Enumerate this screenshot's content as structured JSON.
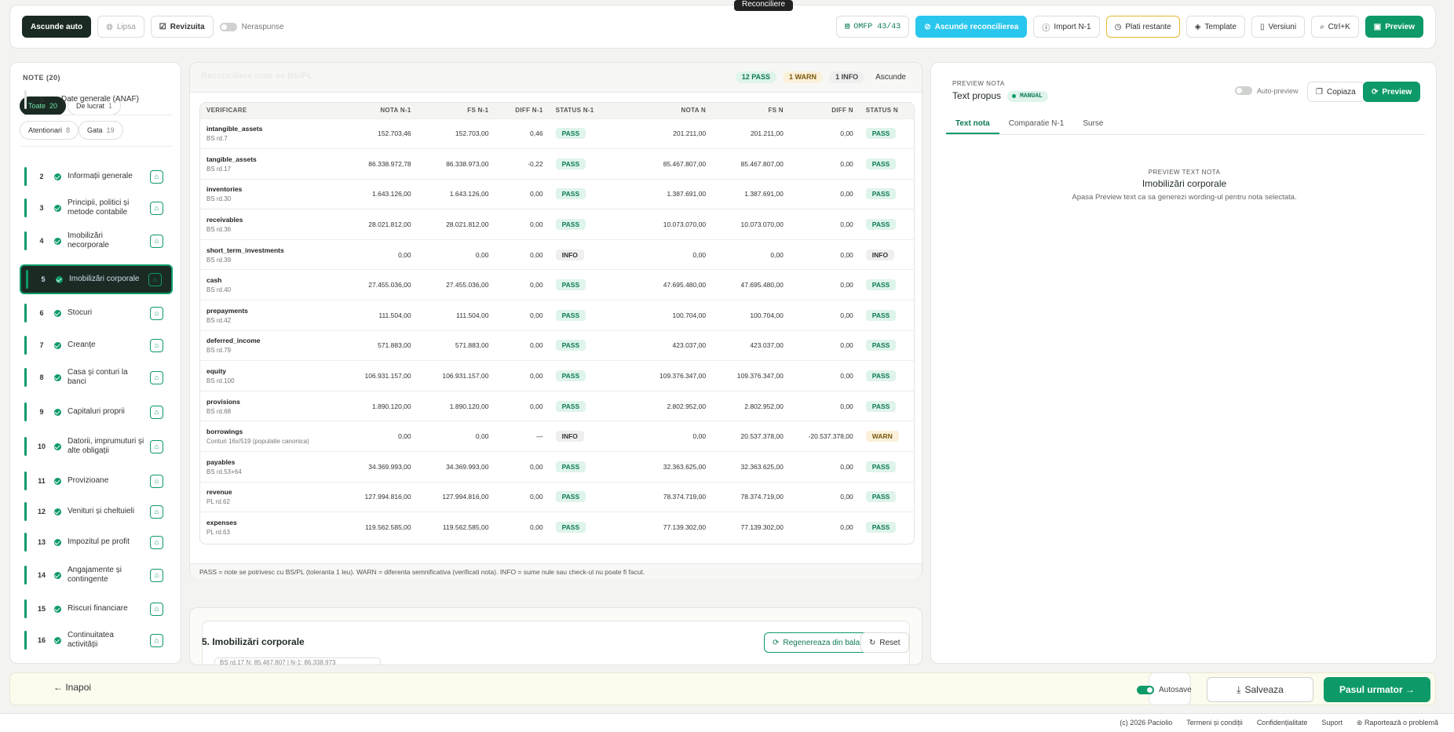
{
  "topbar": {
    "hide_auto": "Ascunde auto",
    "missing": "Lipsa",
    "reviewed": "Revizuita",
    "unanswered": "Neraspunse",
    "omfp": "OMFP 43/43",
    "tooltip": "Reconciliere",
    "hide_reconciliation": "Ascunde reconcilierea",
    "import": "Import N-1",
    "overdue": "Plati restante",
    "template": "Template",
    "versions": "Versiuni",
    "shortcut": "Ctrl+K",
    "preview": "Preview"
  },
  "sidebar": {
    "title": "NOTE (20)",
    "filters": [
      {
        "label": "Toate",
        "count": "20"
      },
      {
        "label": "De lucrat",
        "count": "1"
      },
      {
        "label": "Atentionari",
        "count": "8"
      },
      {
        "label": "Gata",
        "count": "19"
      }
    ],
    "items": [
      {
        "num": "1",
        "label": "Date generale (ANAF)"
      },
      {
        "num": "2",
        "label": "Informații generale"
      },
      {
        "num": "3",
        "label": "Principii, politici și metode contabile"
      },
      {
        "num": "4",
        "label": "Imobilizări necorporale"
      },
      {
        "num": "5",
        "label": "Imobilizări corporale"
      },
      {
        "num": "6",
        "label": "Stocuri"
      },
      {
        "num": "7",
        "label": "Creanțe"
      },
      {
        "num": "8",
        "label": "Casa și conturi la banci"
      },
      {
        "num": "9",
        "label": "Capitaluri proprii"
      },
      {
        "num": "10",
        "label": "Datorii, imprumuturi și alte obligații"
      },
      {
        "num": "11",
        "label": "Provizioane"
      },
      {
        "num": "12",
        "label": "Venituri și cheltuieli"
      },
      {
        "num": "13",
        "label": "Impozitul pe profit"
      },
      {
        "num": "14",
        "label": "Angajamente și contingente"
      },
      {
        "num": "15",
        "label": "Riscuri financiare"
      },
      {
        "num": "16",
        "label": "Continuitatea activității"
      }
    ]
  },
  "recon": {
    "header_faint": "Reconciliere note vs BS/PL",
    "pass": "12 PASS",
    "warn": "1 WARN",
    "info": "1 INFO",
    "hide": "Ascunde",
    "columns": [
      "VERIFICARE",
      "NOTA N-1",
      "FS N-1",
      "DIFF N-1",
      "STATUS N-1",
      "NOTA N",
      "FS N",
      "DIFF N",
      "STATUS N"
    ],
    "rows": [
      {
        "key": "intangible_assets",
        "src": "BS rd.7",
        "nota1": "152.703,46",
        "fs1": "152.703,00",
        "diff1": "0,46",
        "st1": "PASS",
        "nota": "201.211,00",
        "fs": "201.211,00",
        "diff": "0,00",
        "st": "PASS"
      },
      {
        "key": "tangible_assets",
        "src": "BS rd.17",
        "nota1": "86.338.972,78",
        "fs1": "86.338.973,00",
        "diff1": "-0,22",
        "st1": "PASS",
        "nota": "85.467.807,00",
        "fs": "85.467.807,00",
        "diff": "0,00",
        "st": "PASS"
      },
      {
        "key": "inventories",
        "src": "BS rd.30",
        "nota1": "1.643.126,00",
        "fs1": "1.643.126,00",
        "diff1": "0,00",
        "st1": "PASS",
        "nota": "1.387.691,00",
        "fs": "1.387.691,00",
        "diff": "0,00",
        "st": "PASS"
      },
      {
        "key": "receivables",
        "src": "BS rd.36",
        "nota1": "28.021.812,00",
        "fs1": "28.021.812,00",
        "diff1": "0,00",
        "st1": "PASS",
        "nota": "10.073.070,00",
        "fs": "10.073.070,00",
        "diff": "0,00",
        "st": "PASS"
      },
      {
        "key": "short_term_investments",
        "src": "BS rd.39",
        "nota1": "0,00",
        "fs1": "0,00",
        "diff1": "0,00",
        "st1": "INFO",
        "nota": "0,00",
        "fs": "0,00",
        "diff": "0,00",
        "st": "INFO"
      },
      {
        "key": "cash",
        "src": "BS rd.40",
        "nota1": "27.455.036,00",
        "fs1": "27.455.036,00",
        "diff1": "0,00",
        "st1": "PASS",
        "nota": "47.695.480,00",
        "fs": "47.695.480,00",
        "diff": "0,00",
        "st": "PASS"
      },
      {
        "key": "prepayments",
        "src": "BS rd.42",
        "nota1": "111.504,00",
        "fs1": "111.504,00",
        "diff1": "0,00",
        "st1": "PASS",
        "nota": "100.704,00",
        "fs": "100.704,00",
        "diff": "0,00",
        "st": "PASS"
      },
      {
        "key": "deferred_income",
        "src": "BS rd.79",
        "nota1": "571.883,00",
        "fs1": "571.883,00",
        "diff1": "0,00",
        "st1": "PASS",
        "nota": "423.037,00",
        "fs": "423.037,00",
        "diff": "0,00",
        "st": "PASS"
      },
      {
        "key": "equity",
        "src": "BS rd.100",
        "nota1": "106.931.157,00",
        "fs1": "106.931.157,00",
        "diff1": "0,00",
        "st1": "PASS",
        "nota": "109.376.347,00",
        "fs": "109.376.347,00",
        "diff": "0,00",
        "st": "PASS"
      },
      {
        "key": "provisions",
        "src": "BS rd.68",
        "nota1": "1.890.120,00",
        "fs1": "1.890.120,00",
        "diff1": "0,00",
        "st1": "PASS",
        "nota": "2.802.952,00",
        "fs": "2.802.952,00",
        "diff": "0,00",
        "st": "PASS"
      },
      {
        "key": "borrowings",
        "src": "Conturi 16x/519 (populatie canonica)",
        "nota1": "0,00",
        "fs1": "0,00",
        "diff1": "—",
        "st1": "INFO",
        "nota": "0,00",
        "fs": "20.537.378,00",
        "diff": "-20.537.378,00",
        "st": "WARN"
      },
      {
        "key": "payables",
        "src": "BS rd.53+64",
        "nota1": "34.369.993,00",
        "fs1": "34.369.993,00",
        "diff1": "0,00",
        "st1": "PASS",
        "nota": "32.363.625,00",
        "fs": "32.363.625,00",
        "diff": "0,00",
        "st": "PASS"
      },
      {
        "key": "revenue",
        "src": "PL rd.62",
        "nota1": "127.994.816,00",
        "fs1": "127.994.816,00",
        "diff1": "0,00",
        "st1": "PASS",
        "nota": "78.374.719,00",
        "fs": "78.374.719,00",
        "diff": "0,00",
        "st": "PASS"
      },
      {
        "key": "expenses",
        "src": "PL rd.63",
        "nota1": "119.562.585,00",
        "fs1": "119.562.585,00",
        "diff1": "0,00",
        "st1": "PASS",
        "nota": "77.139.302,00",
        "fs": "77.139.302,00",
        "diff": "0,00",
        "st": "PASS"
      }
    ],
    "legend": "PASS = note se potrivesc cu BS/PL (toleranta 1 leu). WARN = diferenta semnificativa (verificati nota). INFO = sume nule sau check-ul nu poate fi facut."
  },
  "section": {
    "title": "5. Imobilizări corporale",
    "regen": "Regenereaza din balanta",
    "reset": "Reset",
    "snippet": "BS rd.17 N: 85.467.807 | N-1: 86.338.973"
  },
  "preview": {
    "tag": "PREVIEW NOTA",
    "title": "Text propus",
    "badge": "MANUAL",
    "auto_preview": "Auto-preview",
    "copy": "Copiaza",
    "button": "Preview",
    "tabs": [
      "Text nota",
      "Comparatie N-1",
      "Surse"
    ],
    "empty_tag": "PREVIEW TEXT NOTA",
    "empty_title": "Imobilizări corporale",
    "empty_hint": "Apasa Preview text ca sa generezi wording-ul pentru nota selectata."
  },
  "footer": {
    "back": "← Inapoi",
    "autosave": "Autosave",
    "save": "Salveaza",
    "next": "Pasul urmator →"
  },
  "legal": {
    "copyright": "(c) 2026 Paciolio",
    "terms": "Termeni și condiții",
    "privacy": "Confidențialitate",
    "support": "Suport",
    "report": "Raportează o problemă"
  }
}
